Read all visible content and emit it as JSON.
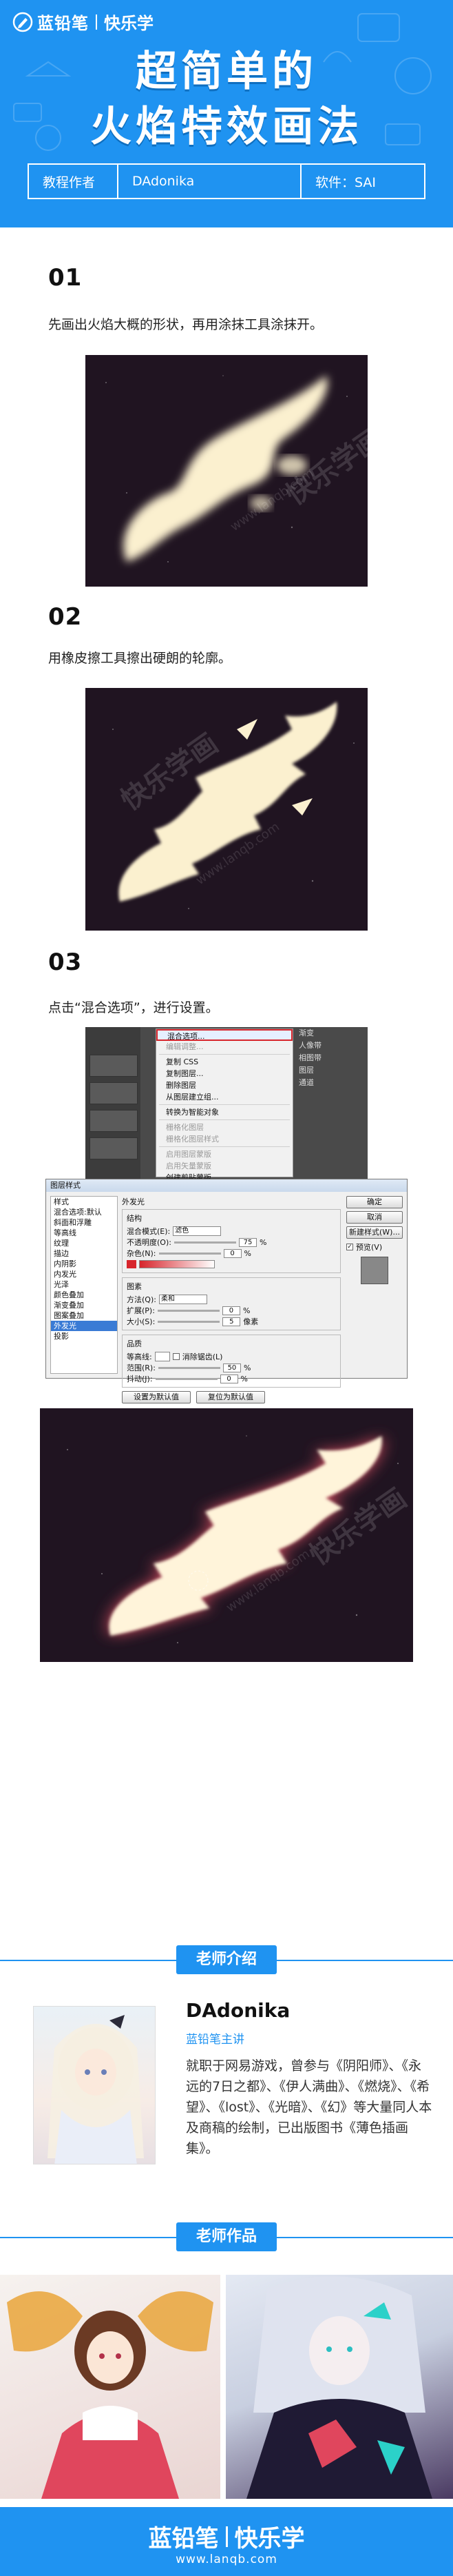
{
  "header": {
    "brand_name": "蓝铅笔",
    "brand_sub": "快乐学",
    "title_line1": "超简单的",
    "title_line2": "火焰特效画法",
    "author_label": "教程作者",
    "author_name": "DAdonika",
    "software": "软件：SAI",
    "colors": {
      "primary": "#1f93f1",
      "canvas": "#201421",
      "flame": "#fbf0cf"
    }
  },
  "steps": [
    {
      "num": "01",
      "text": "先画出火焰大概的形状，再用涂抹工具涂抹开。"
    },
    {
      "num": "02",
      "text": "用橡皮擦工具擦出硬朗的轮廓。"
    },
    {
      "num": "03",
      "text": "点击“混合选项”，进行设置。"
    }
  ],
  "watermark": {
    "text": "快乐学画",
    "url": "www.lanqb.com"
  },
  "ps_menu": {
    "items": [
      {
        "label": "混合选项...",
        "state": "highlight"
      },
      {
        "label": "编辑调整...",
        "state": "disabled"
      },
      {
        "label": "sep"
      },
      {
        "label": "复制 CSS",
        "state": "normal"
      },
      {
        "label": "复制图层...",
        "state": "normal"
      },
      {
        "label": "删除图层",
        "state": "normal"
      },
      {
        "label": "从图层建立组...",
        "state": "normal"
      },
      {
        "label": "sep"
      },
      {
        "label": "转换为智能对象",
        "state": "normal"
      },
      {
        "label": "sep"
      },
      {
        "label": "栅格化图层",
        "state": "disabled"
      },
      {
        "label": "栅格化图层样式",
        "state": "disabled"
      },
      {
        "label": "sep"
      },
      {
        "label": "启用图层蒙版",
        "state": "disabled"
      },
      {
        "label": "启用矢量蒙版",
        "state": "disabled"
      },
      {
        "label": "创建剪贴蒙版",
        "state": "normal"
      }
    ],
    "side_labels": [
      "渐变",
      "人像带",
      "相图带",
      "图层",
      "通道"
    ]
  },
  "dialog": {
    "title": "图层样式",
    "list": [
      "样式",
      "混合选项:默认",
      "斜面和浮雕",
      "等高线",
      "纹理",
      "描边",
      "内阴影",
      "内发光",
      "光泽",
      "颜色叠加",
      "渐变叠加",
      "图案叠加",
      "外发光",
      "投影"
    ],
    "selected_index": 12,
    "outer_glow": "外发光",
    "structure": "结构",
    "blend_mode_label": "混合模式(E):",
    "blend_mode": "滤色",
    "opacity_label": "不透明度(O):",
    "opacity_value": "75",
    "noise_label": "杂色(N):",
    "noise_value": "0",
    "elements": "图素",
    "method_label": "方法(Q):",
    "method": "柔和",
    "spread_label": "扩展(P):",
    "spread_value": "0",
    "size_label": "大小(S):",
    "size_value": "5",
    "px": "像素",
    "quality": "品质",
    "contour_label": "等高线:",
    "anti_alias": "消除锯齿(L)",
    "range_label": "范围(R):",
    "range_value": "50",
    "jitter_label": "抖动(J):",
    "jitter_value": "0",
    "set_default": "设置为默认值",
    "reset_default": "复位为默认值",
    "buttons": [
      "确定",
      "取消",
      "新建样式(W)...",
      "预览(V)"
    ],
    "percent": "%"
  },
  "teacher": {
    "section_title": "老师介绍",
    "name": "DAdonika",
    "role": "蓝铅笔主讲",
    "bio": "就职于网易游戏，曾参与《阴阳师》、《永远的7日之都》、《伊人满曲》、《燃烧》、《希望》、《lost》、《光暗》、《幻》等大量同人本及商稿的绘制，已出版图书《薄色插画集》。"
  },
  "works": {
    "section_title": "老师作品"
  },
  "footer": {
    "brand_name": "蓝铅笔",
    "brand_sub": "快乐学",
    "url": "www.lanqb.com"
  }
}
